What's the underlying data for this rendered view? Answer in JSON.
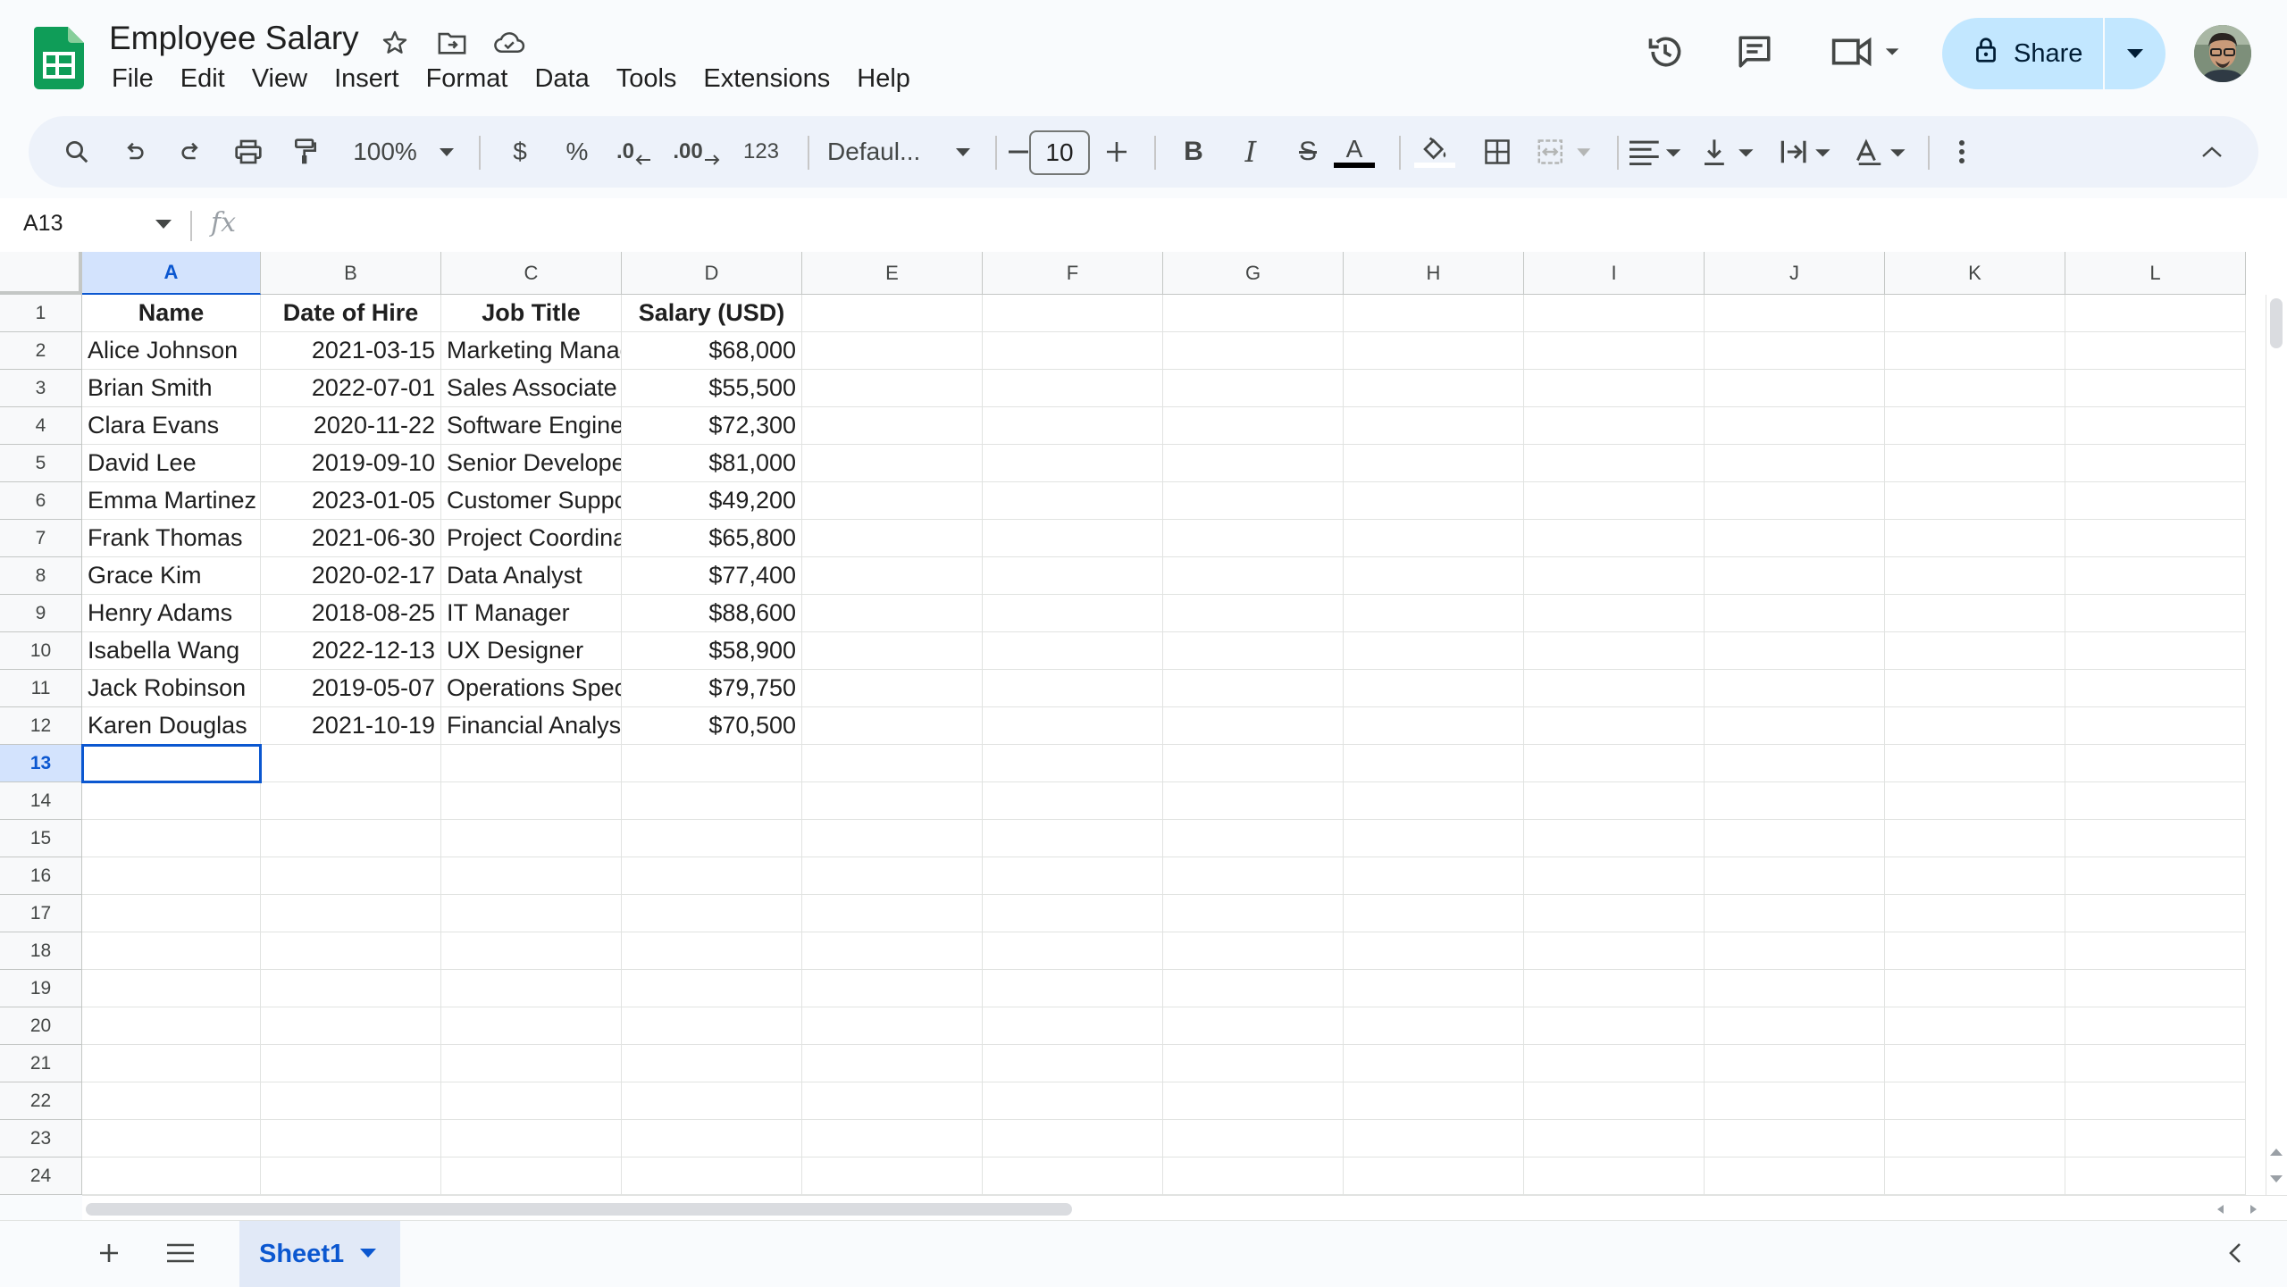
{
  "app": {
    "document_title": "Employee Salary",
    "menu": [
      "File",
      "Edit",
      "View",
      "Insert",
      "Format",
      "Data",
      "Tools",
      "Extensions",
      "Help"
    ],
    "share_label": "Share"
  },
  "toolbar": {
    "zoom": "100%",
    "currency_label": "$",
    "percent_label": "%",
    "decrease_decimal_label": ".0",
    "increase_decimal_label": ".00",
    "number_format_label": "123",
    "font_name": "Defaul...",
    "font_size": "10",
    "bold_label": "B",
    "italic_label": "I",
    "strikethrough_label": "S",
    "text_color_label": "A"
  },
  "formula_bar": {
    "name_box": "A13",
    "fx_label": "fx",
    "formula": ""
  },
  "grid": {
    "columns": [
      "A",
      "B",
      "C",
      "D",
      "E",
      "F",
      "G",
      "H",
      "I",
      "J",
      "K",
      "L"
    ],
    "row_numbers": [
      "1",
      "2",
      "3",
      "4",
      "5",
      "6",
      "7",
      "8",
      "9",
      "10",
      "11",
      "12",
      "13",
      "14",
      "15",
      "16",
      "17",
      "18",
      "19",
      "20",
      "21",
      "22",
      "23",
      "24"
    ],
    "selected_cell": "A13",
    "header_row": [
      "Name",
      "Date of Hire",
      "Job Title",
      "Salary (USD)"
    ],
    "rows": [
      [
        "Alice Johnson",
        "2021-03-15",
        "Marketing Manager",
        "$68,000"
      ],
      [
        "Brian Smith",
        "2022-07-01",
        "Sales Associate",
        "$55,500"
      ],
      [
        "Clara Evans",
        "2020-11-22",
        "Software Engineer",
        "$72,300"
      ],
      [
        "David Lee",
        "2019-09-10",
        "Senior Developer",
        "$81,000"
      ],
      [
        "Emma Martinez",
        "2023-01-05",
        "Customer Support",
        "$49,200"
      ],
      [
        "Frank Thomas",
        "2021-06-30",
        "Project Coordinator",
        "$65,800"
      ],
      [
        "Grace Kim",
        "2020-02-17",
        "Data Analyst",
        "$77,400"
      ],
      [
        "Henry Adams",
        "2018-08-25",
        "IT Manager",
        "$88,600"
      ],
      [
        "Isabella Wang",
        "2022-12-13",
        "UX Designer",
        "$58,900"
      ],
      [
        "Jack Robinson",
        "2019-05-07",
        "Operations Specialist",
        "$79,750"
      ],
      [
        "Karen Douglas",
        "2021-10-19",
        "Financial Analyst",
        "$70,500"
      ]
    ]
  },
  "sheets": {
    "active": "Sheet1"
  },
  "colors": {
    "accent": "#0b57d0",
    "share_bg": "#c2e7ff",
    "toolbar_bg": "#edf2fa",
    "sheets_green": "#0f9d58"
  }
}
